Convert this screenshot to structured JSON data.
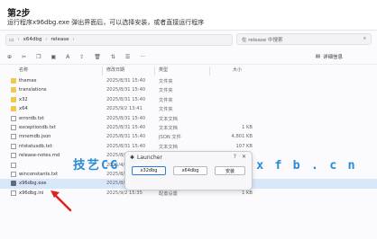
{
  "step": {
    "title": "第2步",
    "description": "运行程序x96dbg.exe 弹出界面后，可以选择安装，或者直接运行程序"
  },
  "address": {
    "crumbs": [
      "x64dbg",
      "release"
    ],
    "search_placeholder": "在 release 中搜索"
  },
  "toolbar": {
    "sort_label": "排序",
    "view_label": "查看",
    "details_label": "详细信息"
  },
  "columns": {
    "name": "名称",
    "date": "修改日期",
    "type": "类型",
    "size": "大小"
  },
  "files": [
    {
      "name": "themes",
      "date": "2025/8/31 15:40",
      "type": "文件夹",
      "size": "",
      "kind": "folder"
    },
    {
      "name": "translations",
      "date": "2025/8/31 15:40",
      "type": "文件夹",
      "size": "",
      "kind": "folder"
    },
    {
      "name": "x32",
      "date": "2025/8/31 15:40",
      "type": "文件夹",
      "size": "",
      "kind": "folder"
    },
    {
      "name": "x64",
      "date": "2025/9/2 13:41",
      "type": "文件夹",
      "size": "",
      "kind": "folder"
    },
    {
      "name": "errordb.txt",
      "date": "2025/8/31 15:40",
      "type": "文本文档",
      "size": "",
      "kind": "file"
    },
    {
      "name": "exceptiondb.txt",
      "date": "2025/8/31 15:40",
      "type": "文本文档",
      "size": "1 KB",
      "kind": "file"
    },
    {
      "name": "mnemdb.json",
      "date": "2025/8/31 15:40",
      "type": "JSON 文件",
      "size": "4,801 KB",
      "kind": "file"
    },
    {
      "name": "ntstatusdb.txt",
      "date": "2025/8/31 15:40",
      "type": "文本文档",
      "size": "107 KB",
      "kind": "file"
    },
    {
      "name": "release-notes.md",
      "date": "2025/8/31 15:40",
      "type": "",
      "size": "6 KB",
      "kind": "file"
    },
    {
      "name": "",
      "date": "2025/4/5",
      "type": "",
      "size": "",
      "kind": "file"
    },
    {
      "name": "winconstants.txt",
      "date": "2025/8/31 15:40",
      "type": "文本文档",
      "size": "5 KB",
      "kind": "file"
    },
    {
      "name": "x96dbg.exe",
      "date": "2025/8/31 15:40",
      "type": "应用程序",
      "size": "195 KB",
      "kind": "exe",
      "selected": true
    },
    {
      "name": "x96dbg.ini",
      "date": "2025/9/2 15:35",
      "type": "配置设置",
      "size": "1 KB",
      "kind": "file"
    }
  ],
  "watermark": "技艺CG  w w w . q d x x f b . c n",
  "launcher": {
    "title": "Launcher",
    "btn_x32": "x32dbg",
    "btn_x64": "x64dbg",
    "btn_install": "安装"
  },
  "colors": {
    "accent": "#2c7be0",
    "selected_row": "#d9e7fb",
    "watermark": "#2a8bd6",
    "arrow": "#e02020"
  }
}
